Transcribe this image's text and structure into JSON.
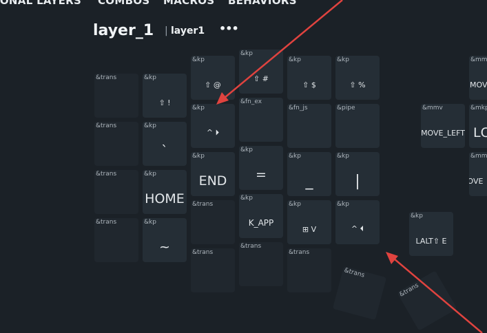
{
  "nav": {
    "items": [
      "IONAL LAYERS",
      "COMBOS",
      "MACROS",
      "BEHAVIORS"
    ]
  },
  "layer": {
    "name": "layer_1",
    "separator": "|",
    "id": "layer1",
    "more": "•••"
  },
  "keys": [
    {
      "behavior": "&trans",
      "label": ""
    },
    {
      "behavior": "&kp",
      "label": "⇧ !"
    },
    {
      "behavior": "&kp",
      "label": "⇧ @"
    },
    {
      "behavior": "&kp",
      "label": "⇧ #"
    },
    {
      "behavior": "&kp",
      "label": "⇧ $"
    },
    {
      "behavior": "&kp",
      "label": "⇧ %"
    },
    {
      "behavior": "&trans",
      "label": ""
    },
    {
      "behavior": "&kp",
      "label": "`"
    },
    {
      "behavior": "&kp",
      "label": "^ ⏵"
    },
    {
      "behavior": "&fn_ex",
      "label": ""
    },
    {
      "behavior": "&fn_js",
      "label": ""
    },
    {
      "behavior": "&pipe",
      "label": ""
    },
    {
      "behavior": "&trans",
      "label": ""
    },
    {
      "behavior": "&kp",
      "label": "HOME"
    },
    {
      "behavior": "&kp",
      "label": "END"
    },
    {
      "behavior": "&kp",
      "label": "="
    },
    {
      "behavior": "&kp",
      "label": "_"
    },
    {
      "behavior": "&kp",
      "label": "|"
    },
    {
      "behavior": "&trans",
      "label": ""
    },
    {
      "behavior": "&kp",
      "label": "~"
    },
    {
      "behavior": "&trans",
      "label": ""
    },
    {
      "behavior": "&kp",
      "label": "K_APP"
    },
    {
      "behavior": "&kp",
      "label": "⊞ V"
    },
    {
      "behavior": "&kp",
      "label": "^ ⏴"
    },
    {
      "behavior": "&trans",
      "label": ""
    },
    {
      "behavior": "&trans",
      "label": ""
    },
    {
      "behavior": "&trans",
      "label": ""
    },
    {
      "behavior": "&trans",
      "label": ""
    },
    {
      "behavior": "&trans",
      "label": ""
    },
    {
      "behavior": "&mmv",
      "label": "MOVE_LEFT"
    },
    {
      "behavior": "&kp",
      "label": "LALT⇧ E"
    },
    {
      "behavior": "&mmv",
      "label": "MOVE"
    },
    {
      "behavior": "&mkp",
      "label": "LC"
    },
    {
      "behavior": "&mmv",
      "label": "MOVE"
    }
  ],
  "colors": {
    "background": "#1b2127",
    "key": "#252e36",
    "annotation_arrow": "#e0433f"
  }
}
